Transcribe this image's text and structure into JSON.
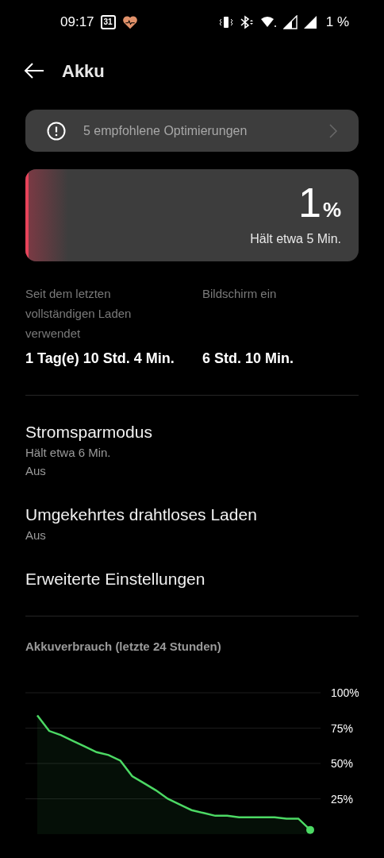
{
  "status_bar": {
    "time": "09:17",
    "calendar_date": "31",
    "battery": "1 %"
  },
  "header": {
    "title": "Akku"
  },
  "recommendation": {
    "label": "5 empfohlene Optimierungen"
  },
  "battery_card": {
    "percent": "1",
    "unit": "%",
    "level": 0.01,
    "estimate": "Hält etwa 5 Min."
  },
  "stats": [
    {
      "label": "Seit dem letzten vollständigen Laden verwendet",
      "value": "1 Tag(e) 10 Std. 4 Min."
    },
    {
      "label": "Bildschirm ein",
      "value": "6 Std. 10 Min."
    }
  ],
  "settings": [
    {
      "title": "Stromsparmodus",
      "subtitles": [
        "Hält etwa 6 Min.",
        "Aus"
      ]
    },
    {
      "title": "Umgekehrtes drahtloses Laden",
      "subtitles": [
        "Aus"
      ]
    },
    {
      "title": "Erweiterte Einstellungen"
    }
  ],
  "usage": {
    "title": "Akkuverbrauch (letzte 24 Stunden)",
    "chart_data": {
      "type": "area",
      "grid": true,
      "ylim": [
        0,
        100
      ],
      "yticks": [
        {
          "value": 100,
          "label": "100%"
        },
        {
          "value": 75,
          "label": "75%"
        },
        {
          "value": 50,
          "label": "50%"
        },
        {
          "value": 25,
          "label": "25%"
        }
      ],
      "series": [
        {
          "color": "#4cd964",
          "values": [
            84,
            73,
            70,
            66,
            62,
            58,
            56,
            52,
            41,
            36,
            31,
            25,
            21,
            17,
            15,
            13,
            13,
            12,
            12,
            12,
            12,
            11,
            11,
            3
          ]
        }
      ]
    }
  }
}
